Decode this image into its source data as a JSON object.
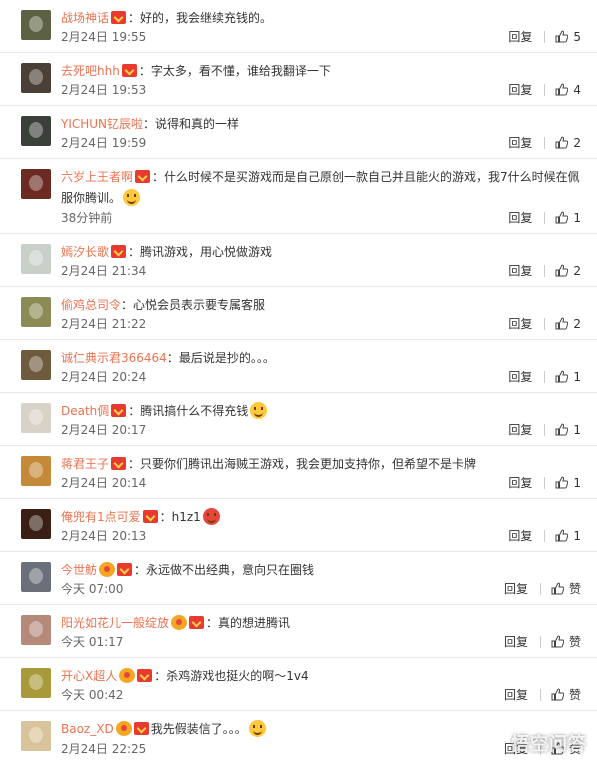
{
  "comments": [
    {
      "username": "战场神话",
      "vip": true,
      "medal": false,
      "text": "：好的，我会继续充钱的。",
      "emoji_after": false,
      "time": "2月24日 19:55",
      "reply": "回复",
      "likes": "5",
      "avatar_color": "#5c6144"
    },
    {
      "username": "去死吧hhh",
      "vip": true,
      "medal": false,
      "text": "：字太多，看不懂，谁给我翻译一下",
      "emoji_after": false,
      "time": "2月24日 19:53",
      "reply": "回复",
      "likes": "4",
      "avatar_color": "#4a4035"
    },
    {
      "username": "YICHUN钇辰啦",
      "vip": false,
      "medal": false,
      "text": "：说得和真的一样",
      "emoji_after": false,
      "time": "2月24日 19:59",
      "reply": "回复",
      "likes": "2",
      "avatar_color": "#3b3f3a"
    },
    {
      "username": "六岁上王者啊",
      "vip": true,
      "medal": false,
      "text": "：什么时候不是买游戏而是自己原创一款自己并且能火的游戏，我7什么时候在佩服你腾训。",
      "emoji_after": true,
      "time": "38分钟前",
      "reply": "回复",
      "likes": "1",
      "avatar_color": "#6b2a22"
    },
    {
      "username": "嫣汐长歌",
      "vip": true,
      "medal": false,
      "text": "：腾讯游戏，用心悦做游戏",
      "emoji_after": false,
      "time": "2月24日 21:34",
      "reply": "回复",
      "likes": "2",
      "avatar_color": "#c9cfc9"
    },
    {
      "username": "偷鸡总司令",
      "vip": false,
      "medal": false,
      "text": "：心悦会员表示要专属客服",
      "emoji_after": false,
      "time": "2月24日 21:22",
      "reply": "回复",
      "likes": "2",
      "avatar_color": "#8c8a55"
    },
    {
      "username": "诚仁典示君366464",
      "vip": false,
      "medal": false,
      "text": "：最后说是抄的。。。",
      "emoji_after": false,
      "time": "2月24日 20:24",
      "reply": "回复",
      "likes": "1",
      "avatar_color": "#6e5a3c"
    },
    {
      "username": "Death倜",
      "vip": true,
      "medal": false,
      "text": "：腾讯搞什么不得充钱",
      "emoji_after": true,
      "time": "2月24日 20:17",
      "reply": "回复",
      "likes": "1",
      "avatar_color": "#d9d2c8"
    },
    {
      "username": "蒋君王子",
      "vip": true,
      "medal": false,
      "text": "：只要你们腾讯出海贼王游戏，我会更加支持你，但希望不是卡牌",
      "emoji_after": false,
      "time": "2月24日 20:14",
      "reply": "回复",
      "likes": "1",
      "avatar_color": "#c48a3a"
    },
    {
      "username": "俺兜有1点可爱",
      "vip": true,
      "medal": false,
      "text": "：h1z1",
      "emoji_after": true,
      "time": "2月24日 20:13",
      "reply": "回复",
      "likes": "1",
      "avatar_color": "#3a1f14"
    },
    {
      "username": "今世鲂",
      "vip": true,
      "medal": true,
      "text": "：永远做不出经典，意向只在圈钱",
      "emoji_after": false,
      "time": "今天 07:00",
      "reply": "回复",
      "likes": "赞",
      "avatar_color": "#6a6f7a"
    },
    {
      "username": "阳光如花儿一般绽放",
      "vip": true,
      "medal": true,
      "text": "：真的想进腾讯",
      "emoji_after": false,
      "time": "今天 01:17",
      "reply": "回复",
      "likes": "赞",
      "avatar_color": "#b58a7a"
    },
    {
      "username": "开心X超人",
      "vip": true,
      "medal": true,
      "text": "：杀鸡游戏也挺火的啊～1v4",
      "emoji_after": false,
      "time": "今天 00:42",
      "reply": "回复",
      "likes": "赞",
      "avatar_color": "#a89a3a"
    },
    {
      "username": "Baoz_XD",
      "vip": true,
      "medal": true,
      "text": "我先假装信了。。。",
      "emoji_after": true,
      "time": "2月24日 22:25",
      "reply": "回复",
      "likes": "赞",
      "avatar_color": "#d8c39a"
    }
  ],
  "watermark": "悟空问答"
}
